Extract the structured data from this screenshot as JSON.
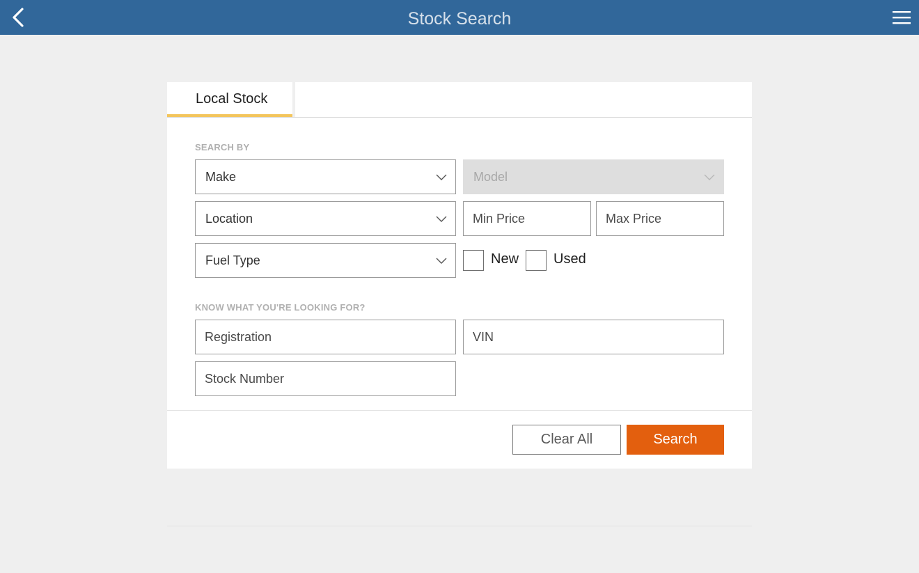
{
  "header": {
    "title": "Stock Search",
    "back_icon": "chevron-left-icon",
    "menu_icon": "hamburger-menu-icon",
    "color": "#31679a"
  },
  "tabs": [
    {
      "label": "Local Stock",
      "active": true
    }
  ],
  "search_by": {
    "label": "SEARCH BY",
    "make": {
      "value": "Make"
    },
    "model": {
      "value": "Model",
      "disabled": true
    },
    "location": {
      "value": "Location"
    },
    "min_price": {
      "placeholder": "Min Price"
    },
    "max_price": {
      "placeholder": "Max Price"
    },
    "fuel_type": {
      "value": "Fuel Type"
    },
    "condition": {
      "new_label": "New",
      "new_checked": false,
      "used_label": "Used",
      "used_checked": false
    }
  },
  "lookup": {
    "label": "KNOW WHAT YOU'RE LOOKING FOR?",
    "registration": {
      "placeholder": "Registration"
    },
    "vin": {
      "placeholder": "VIN"
    },
    "stock_number": {
      "placeholder": "Stock Number"
    }
  },
  "actions": {
    "clear_label": "Clear All",
    "search_label": "Search",
    "search_color": "#e35f0e"
  }
}
